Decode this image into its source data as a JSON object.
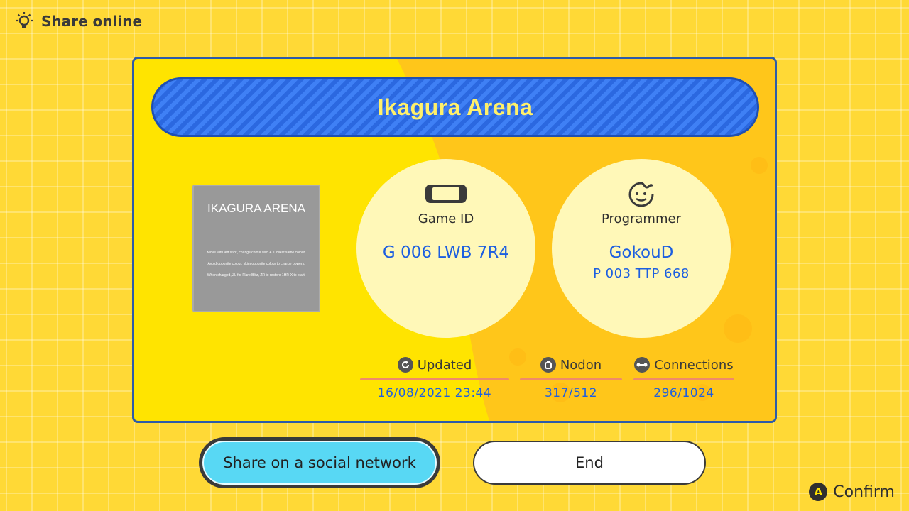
{
  "header": {
    "title": "Share online",
    "icon": "lightbulb-icon"
  },
  "card": {
    "title": "Ikagura Arena",
    "thumbnail": {
      "title": "IKAGURA ARENA",
      "lines": [
        "Move with left stick, change colour with A. Collect same colour.",
        "Avoid opposite colour, skim opposite colour to charge powers.",
        "When charged, ZL for Flare Blitz, ZR to restore 1HP. X to start!"
      ]
    },
    "game_id": {
      "label": "Game ID",
      "value": "G 006 LWB 7R4",
      "icon": "console-icon"
    },
    "programmer": {
      "label": "Programmer",
      "name": "GokouD",
      "id": "P 003 TTP 668",
      "icon": "face-icon"
    },
    "stats": {
      "updated": {
        "label": "Updated",
        "value": "16/08/2021 23:44",
        "icon": "refresh-icon"
      },
      "nodon": {
        "label": "Nodon",
        "value": "317/512",
        "icon": "nodon-icon"
      },
      "connections": {
        "label": "Connections",
        "value": "296/1024",
        "icon": "connection-icon"
      }
    }
  },
  "buttons": {
    "share": "Share on a social network",
    "end": "End"
  },
  "footer": {
    "button_glyph": "A",
    "confirm": "Confirm"
  },
  "colors": {
    "background": "#ffd936",
    "accent_blue": "#1d5fe0",
    "card_border": "#2e5ba8",
    "share_button": "#58d8f4"
  }
}
